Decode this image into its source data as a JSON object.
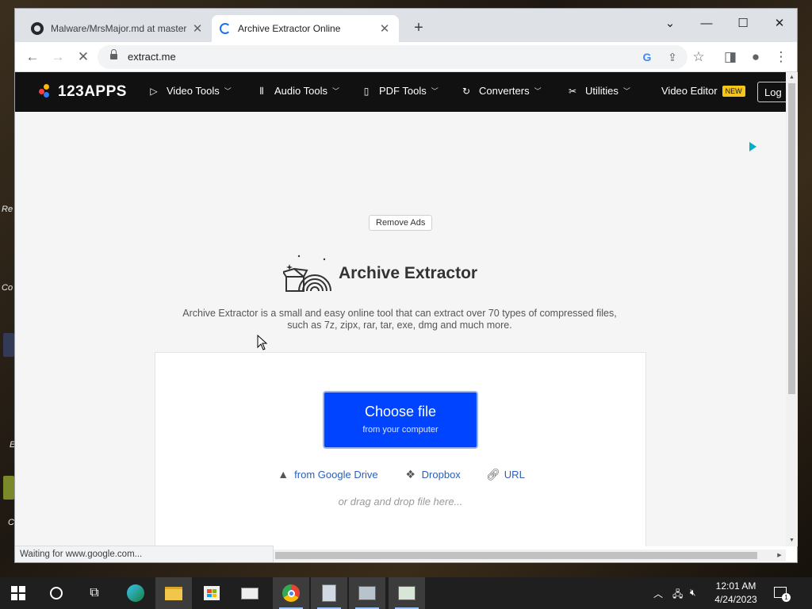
{
  "desktop": {
    "labels": [
      "Re",
      "Co",
      "E",
      "C"
    ]
  },
  "browser": {
    "tabs": [
      {
        "title": "Malware/MrsMajor.md at master",
        "icon": "github-icon",
        "active": false
      },
      {
        "title": "Archive Extractor Online",
        "icon": "loading-spinner-icon",
        "active": true
      }
    ],
    "url": "extract.me",
    "status_text": "Waiting for www.google.com..."
  },
  "site": {
    "logo": "123APPS",
    "nav": [
      {
        "label": "Video Tools",
        "icon": "play-icon"
      },
      {
        "label": "Audio Tools",
        "icon": "waveform-icon"
      },
      {
        "label": "PDF Tools",
        "icon": "document-icon"
      },
      {
        "label": "Converters",
        "icon": "convert-icon"
      },
      {
        "label": "Utilities",
        "icon": "tools-icon"
      }
    ],
    "video_editor": "Video Editor",
    "new_badge": "NEW",
    "login": "Log",
    "remove_ads": "Remove Ads",
    "title": "Archive Extractor",
    "description": "Archive Extractor is a small and easy online tool that can extract over 70 types of compressed files, such as 7z, zipx, rar, tar, exe, dmg and much more.",
    "choose_file": "Choose file",
    "choose_file_sub": "from your computer",
    "sources": [
      {
        "label": "from Google Drive",
        "icon": "google-drive-icon"
      },
      {
        "label": "Dropbox",
        "icon": "dropbox-icon"
      },
      {
        "label": "URL",
        "icon": "link-icon"
      }
    ],
    "drag_hint": "or drag and drop file here...",
    "colors": {
      "nav_bg": "#111111",
      "primary_button": "#0044ff",
      "link": "#2b5fb6",
      "new_badge": "#f5c518"
    }
  },
  "taskbar": {
    "time": "12:01 AM",
    "date": "4/24/2023",
    "notification_count": "1"
  }
}
